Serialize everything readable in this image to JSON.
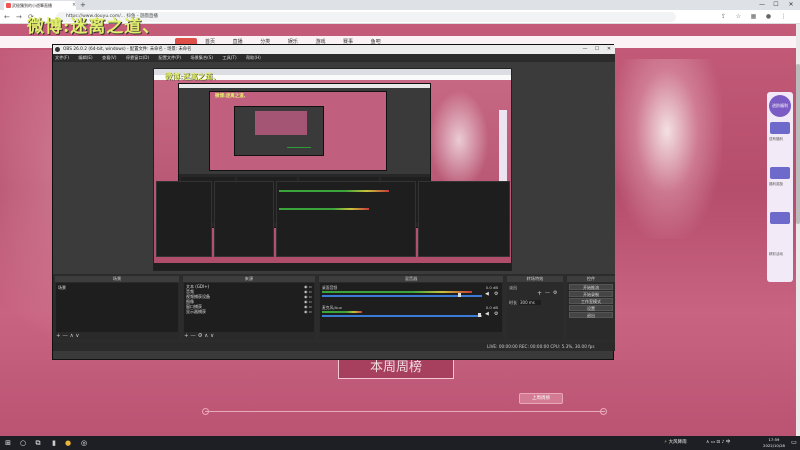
{
  "browser": {
    "tab_title": "武極獨到的小遊筆直播",
    "tab_close": "×",
    "new_tab": "+",
    "minimize": "—",
    "maximize": "☐",
    "close": "✕",
    "url": "https://www.douyu.com/...  抖鱼 - 遊戲直播",
    "back": "←",
    "forward": "→",
    "reload": "⟳"
  },
  "watermark": "微博:迷离之道、",
  "site": {
    "nav_items": [
      "首页",
      "直播",
      "分类",
      "娱乐",
      "游戏",
      "赛事",
      "鱼吧"
    ],
    "weekly_title": "本周周榜",
    "weekly_button": "上周周榜",
    "side_badge": "进阶福利",
    "side_texts": [
      "送有福利",
      "福利奖励",
      "精彩活动"
    ]
  },
  "obs": {
    "title": "OBS 26.0.2 (64-bit, windows) - 配置文件: 未命名 - 场景: 未命名",
    "menu": [
      "文件(F)",
      "编辑(E)",
      "查看(V)",
      "停靠窗口(D)",
      "配置文件(P)",
      "场景集合(S)",
      "工具(T)",
      "帮助(H)"
    ],
    "nested_watermark": "微博:迷离之道、",
    "docks": {
      "scenes": {
        "title": "场景",
        "items": [
          "场景"
        ]
      },
      "sources": {
        "title": "来源",
        "items": [
          "文本 (GDI+)",
          "音频",
          "视频捕获设备",
          "图像",
          "窗口捕获",
          "显示器捕获"
        ]
      },
      "mixer": {
        "title": "混音器",
        "channels": [
          {
            "name": "桌面音频",
            "db": "0.0 dB"
          },
          {
            "name": "麦克风/Aux",
            "db": "0.0 dB"
          }
        ]
      },
      "transitions": {
        "title": "转场特效",
        "type_value": "淡出",
        "duration_label": "时长",
        "duration_value": "300 ms"
      },
      "controls": {
        "title": "控件",
        "buttons": [
          "开始推流",
          "开始录制",
          "工作室模式",
          "设置",
          "退出"
        ]
      }
    },
    "footer": {
      "add": "+",
      "remove": "—",
      "up": "∧",
      "down": "∨",
      "settings": "⚙"
    },
    "status": "LIVE: 00:00:00    REC: 00:00:00    CPU: 5.3%, 30.00 fps"
  },
  "taskbar": {
    "start": "⊞",
    "search": "○",
    "taskview": "⧉",
    "tray_text": "大风降雨",
    "tray_icons": "∧ ▭ ⊡ ♪ 中",
    "time": "17:59",
    "date": "2022/10/28"
  }
}
